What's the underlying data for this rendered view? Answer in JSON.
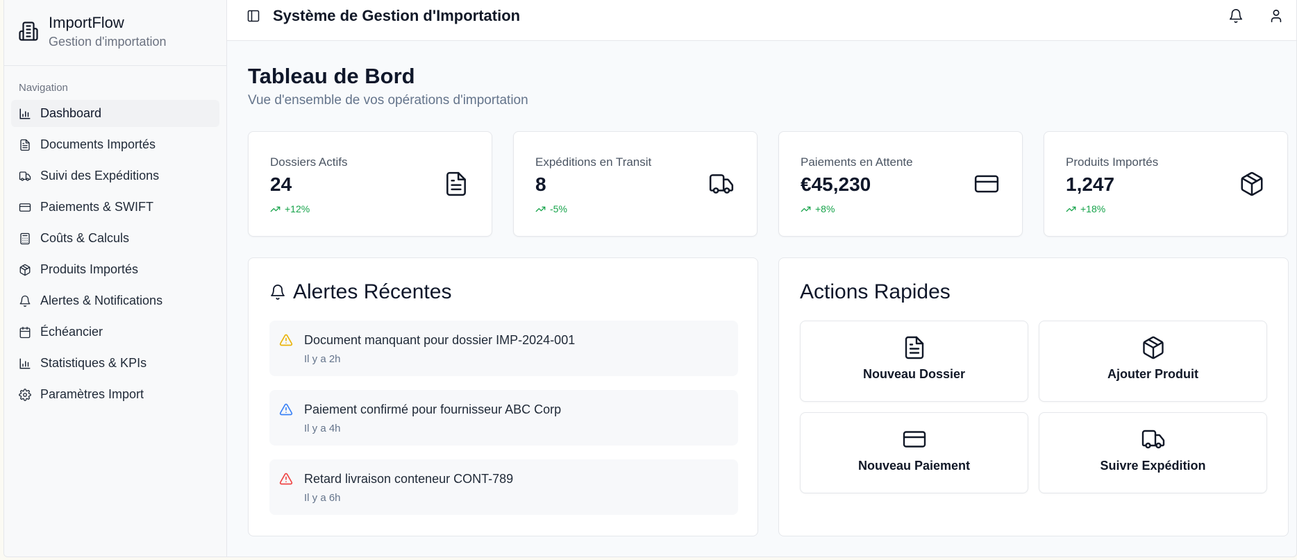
{
  "brand": {
    "name": "ImportFlow",
    "subtitle": "Gestion d'importation"
  },
  "sidebar": {
    "section_label": "Navigation",
    "items": [
      {
        "label": "Dashboard",
        "icon": "bar-chart-icon",
        "active": true
      },
      {
        "label": "Documents Importés",
        "icon": "file-text-icon"
      },
      {
        "label": "Suivi des Expéditions",
        "icon": "truck-icon"
      },
      {
        "label": "Paiements & SWIFT",
        "icon": "credit-card-icon"
      },
      {
        "label": "Coûts & Calculs",
        "icon": "calculator-icon"
      },
      {
        "label": "Produits Importés",
        "icon": "package-icon"
      },
      {
        "label": "Alertes & Notifications",
        "icon": "bell-icon"
      },
      {
        "label": "Échéancier",
        "icon": "calendar-icon"
      },
      {
        "label": "Statistiques & KPIs",
        "icon": "bar-chart-icon"
      },
      {
        "label": "Paramètres Import",
        "icon": "settings-icon"
      }
    ]
  },
  "header": {
    "title": "Système de Gestion d'Importation"
  },
  "page": {
    "title": "Tableau de Bord",
    "subtitle": "Vue d'ensemble de vos opérations d'importation"
  },
  "stats": [
    {
      "label": "Dossiers Actifs",
      "value": "24",
      "trend": "+12%",
      "icon": "file-text-icon"
    },
    {
      "label": "Expéditions en Transit",
      "value": "8",
      "trend": "-5%",
      "icon": "truck-icon"
    },
    {
      "label": "Paiements en Attente",
      "value": "€45,230",
      "trend": "+8%",
      "icon": "credit-card-icon"
    },
    {
      "label": "Produits Importés",
      "value": "1,247",
      "trend": "+18%",
      "icon": "package-icon"
    }
  ],
  "alerts": {
    "title": "Alertes Récentes",
    "items": [
      {
        "message": "Document manquant pour dossier IMP-2024-001",
        "time": "Il y a 2h",
        "color": "#eab308"
      },
      {
        "message": "Paiement confirmé pour fournisseur ABC Corp",
        "time": "Il y a 4h",
        "color": "#3b82f6"
      },
      {
        "message": "Retard livraison conteneur CONT-789",
        "time": "Il y a 6h",
        "color": "#ef4444"
      }
    ]
  },
  "quick_actions": {
    "title": "Actions Rapides",
    "items": [
      {
        "label": "Nouveau Dossier",
        "icon": "file-text-icon"
      },
      {
        "label": "Ajouter Produit",
        "icon": "package-icon"
      },
      {
        "label": "Nouveau Paiement",
        "icon": "credit-card-icon"
      },
      {
        "label": "Suivre Expédition",
        "icon": "truck-icon"
      }
    ]
  },
  "colors": {
    "trend": "#16a34a",
    "text": "#0f172a",
    "muted": "#64748b"
  }
}
